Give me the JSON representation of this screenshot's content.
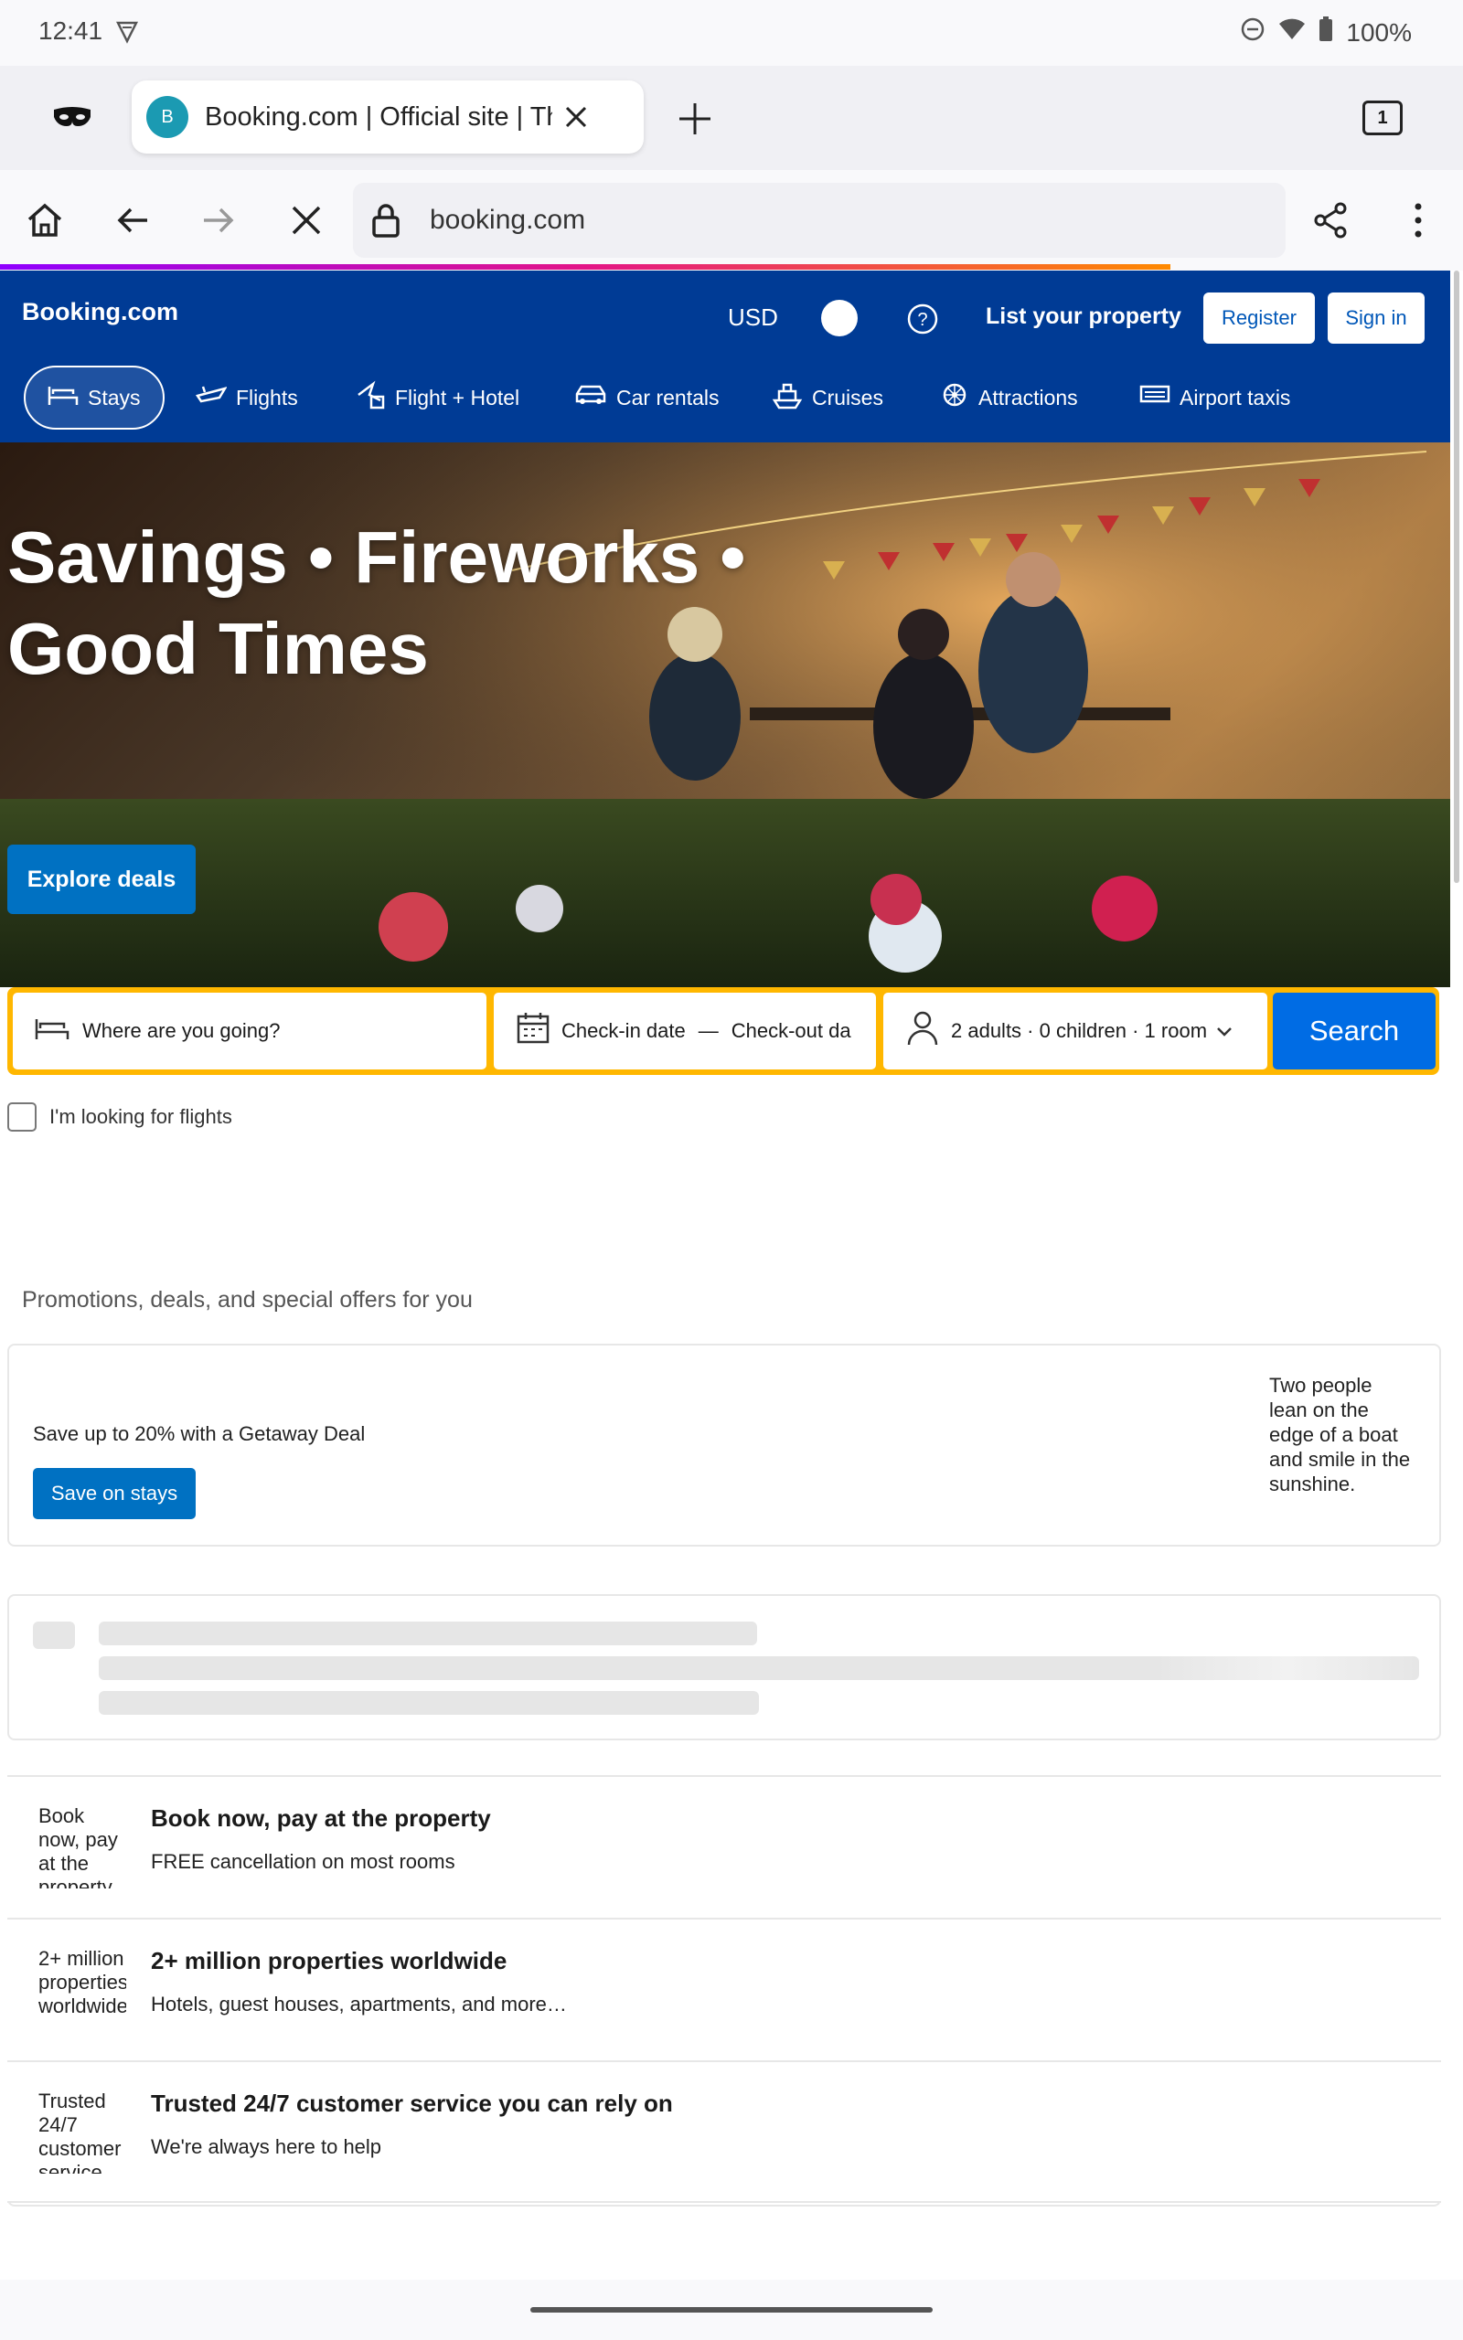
{
  "status_bar": {
    "time": "12:41",
    "battery": "100%"
  },
  "browser": {
    "tab_title": "Booking.com | Official site | Th",
    "tab_favicon_letter": "B",
    "tab_count": "1",
    "url": "booking.com"
  },
  "header": {
    "logo": "Booking.com",
    "currency": "USD",
    "list_property": "List your property",
    "register": "Register",
    "sign_in": "Sign in"
  },
  "nav": {
    "items": [
      {
        "label": "Stays",
        "icon": "bed-icon"
      },
      {
        "label": "Flights",
        "icon": "plane-icon"
      },
      {
        "label": "Flight + Hotel",
        "icon": "flight-hotel-icon"
      },
      {
        "label": "Car rentals",
        "icon": "car-icon"
      },
      {
        "label": "Cruises",
        "icon": "ship-icon"
      },
      {
        "label": "Attractions",
        "icon": "attractions-icon"
      },
      {
        "label": "Airport taxis",
        "icon": "taxi-icon"
      }
    ]
  },
  "hero": {
    "title_line1": "Savings • Fireworks •",
    "title_line2": "Good Times",
    "cta": "Explore deals"
  },
  "search": {
    "destination_placeholder": "Where are you going?",
    "checkin": "Check-in date",
    "dash": "—",
    "checkout": "Check-out da",
    "guests": "2 adults · 0 children · 1 room",
    "button": "Search",
    "flights_checkbox": "I'm looking for flights"
  },
  "promotions": {
    "section_title": "Promotions, deals, and special offers for you",
    "text": "Save up to 20% with a Getaway Deal",
    "button": "Save on stays",
    "image_alt": "Two people lean on the edge of a boat and smile in the sunshine."
  },
  "benefits": [
    {
      "small": "Book now, pay at the property",
      "title": "Book now, pay at the property",
      "subtitle": "FREE cancellation on most rooms"
    },
    {
      "small": "2+ million properties worldwide",
      "title": "2+ million properties worldwide",
      "subtitle": "Hotels, guest houses, apartments, and more…"
    },
    {
      "small": "Trusted 24/7 customer service",
      "title": "Trusted 24/7 customer service you can rely on",
      "subtitle": "We're always here to help"
    }
  ]
}
